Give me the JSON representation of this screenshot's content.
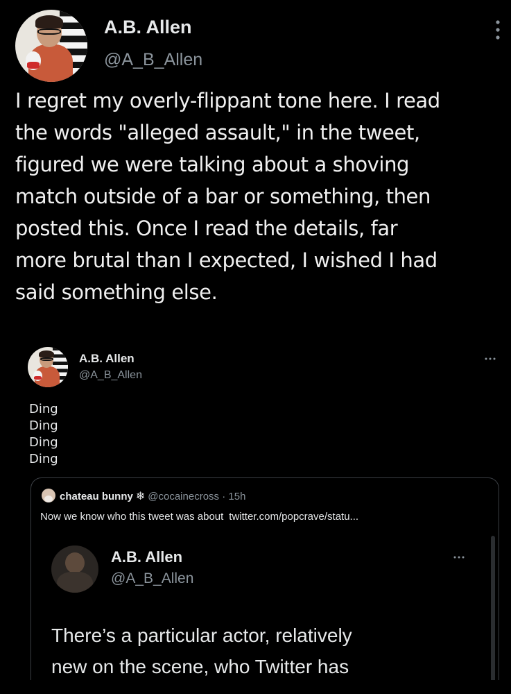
{
  "main_tweet": {
    "display_name": "A.B. Allen",
    "handle": "@A_B_Allen",
    "more_icon": "vertical-ellipsis",
    "text_lines": [
      "I regret my overly-flippant tone here. I read",
      "the words \"alleged assault,\" in the tweet,",
      "figured we were talking about a shoving",
      "match outside of a bar or something, then",
      "posted this. Once I read the details, far",
      "more brutal than I expected, I wished I had",
      "said something else."
    ]
  },
  "quoted_tweet": {
    "display_name": "A.B. Allen",
    "handle": "@A_B_Allen",
    "more_icon": "horizontal-ellipsis",
    "lines": [
      "Ding",
      "Ding",
      "Ding",
      "Ding"
    ],
    "quote": {
      "author_name": "chateau bunny",
      "author_emoji": "snowflake",
      "author_handle": "@cocainecross",
      "time": "· 15h",
      "text": "Now we know who this tweet was about",
      "link": "twitter.com/popcrave/statu...",
      "nested": {
        "display_name": "A.B. Allen",
        "handle": "@A_B_Allen",
        "more_icon": "horizontal-ellipsis",
        "text_lines": [
          "There’s a particular actor, relatively",
          "new on the scene, who Twitter has"
        ]
      }
    }
  },
  "colors": {
    "background": "#000000",
    "text": "#e7e9ea",
    "secondary_text": "#8b949c",
    "border": "#3b3f44"
  }
}
